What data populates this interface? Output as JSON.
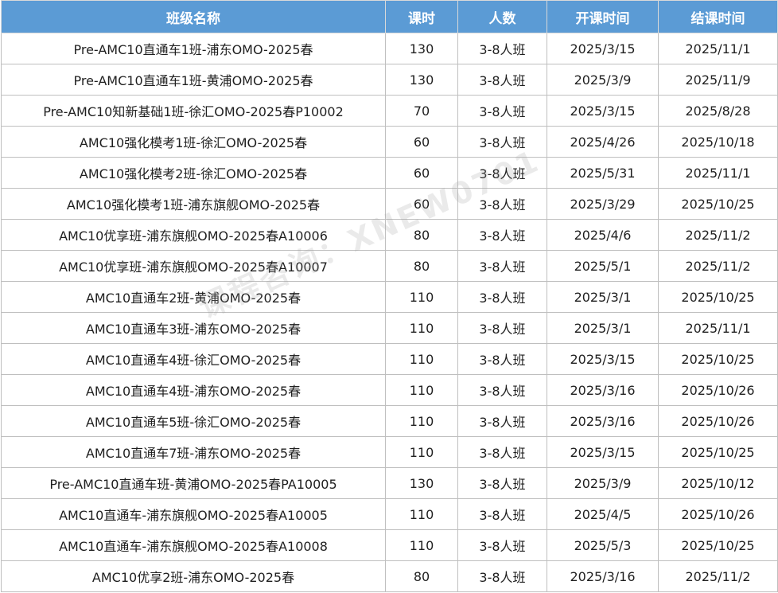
{
  "table": {
    "headers": [
      "班级名称",
      "课时",
      "人数",
      "开课时间",
      "结课时间"
    ],
    "rows": [
      [
        "Pre-AMC10直通车1班-浦东OMO-2025春",
        "130",
        "3-8人班",
        "2025/3/15",
        "2025/11/1"
      ],
      [
        "Pre-AMC10直通车1班-黄浦OMO-2025春",
        "130",
        "3-8人班",
        "2025/3/9",
        "2025/11/9"
      ],
      [
        "Pre-AMC10知新基础1班-徐汇OMO-2025春P10002",
        "70",
        "3-8人班",
        "2025/3/15",
        "2025/8/28"
      ],
      [
        "AMC10强化模考1班-徐汇OMO-2025春",
        "60",
        "3-8人班",
        "2025/4/26",
        "2025/10/18"
      ],
      [
        "AMC10强化模考2班-徐汇OMO-2025春",
        "60",
        "3-8人班",
        "2025/5/31",
        "2025/11/1"
      ],
      [
        "AMC10强化模考1班-浦东旗舰OMO-2025春",
        "60",
        "3-8人班",
        "2025/3/29",
        "2025/10/25"
      ],
      [
        "AMC10优享班-浦东旗舰OMO-2025春A10006",
        "80",
        "3-8人班",
        "2025/4/6",
        "2025/11/2"
      ],
      [
        "AMC10优享班-浦东旗舰OMO-2025春A10007",
        "80",
        "3-8人班",
        "2025/5/1",
        "2025/11/2"
      ],
      [
        "AMC10直通车2班-黄浦OMO-2025春",
        "110",
        "3-8人班",
        "2025/3/1",
        "2025/10/25"
      ],
      [
        "AMC10直通车3班-浦东OMO-2025春",
        "110",
        "3-8人班",
        "2025/3/1",
        "2025/11/1"
      ],
      [
        "AMC10直通车4班-徐汇OMO-2025春",
        "110",
        "3-8人班",
        "2025/3/15",
        "2025/10/25"
      ],
      [
        "AMC10直通车4班-浦东OMO-2025春",
        "110",
        "3-8人班",
        "2025/3/16",
        "2025/10/26"
      ],
      [
        "AMC10直通车5班-徐汇OMO-2025春",
        "110",
        "3-8人班",
        "2025/3/16",
        "2025/10/26"
      ],
      [
        "AMC10直通车7班-浦东OMO-2025春",
        "110",
        "3-8人班",
        "2025/3/15",
        "2025/10/25"
      ],
      [
        "Pre-AMC10直通车班-黄浦OMO-2025春PA10005",
        "130",
        "3-8人班",
        "2025/3/9",
        "2025/10/12"
      ],
      [
        "AMC10直通车-浦东旗舰OMO-2025春A10005",
        "110",
        "3-8人班",
        "2025/4/5",
        "2025/10/26"
      ],
      [
        "AMC10直通车-浦东旗舰OMO-2025春A10008",
        "110",
        "3-8人班",
        "2025/5/3",
        "2025/10/25"
      ],
      [
        "AMC10优享2班-浦东OMO-2025春",
        "80",
        "3-8人班",
        "2025/3/16",
        "2025/11/2"
      ]
    ]
  },
  "watermark": "课程咨询：XNEW0701",
  "colors": {
    "header_bg": "#5b9bd5",
    "header_text": "#ffffff",
    "grid": "#bfbfbf"
  }
}
